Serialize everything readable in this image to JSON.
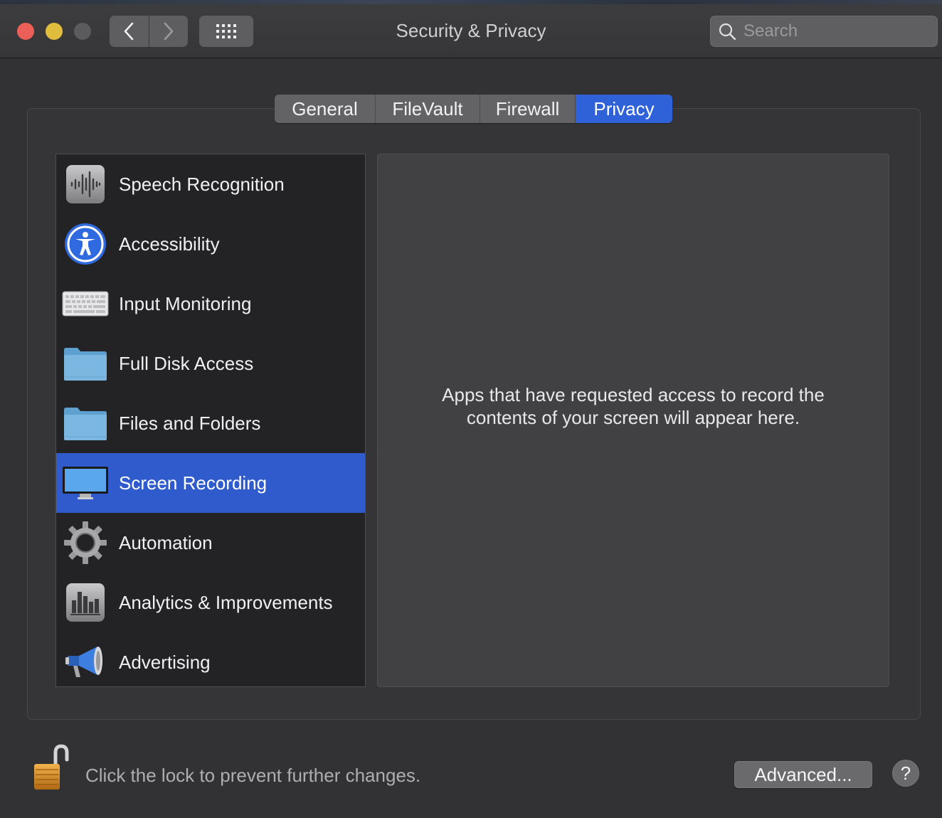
{
  "window": {
    "title": "Security & Privacy"
  },
  "search": {
    "placeholder": "Search"
  },
  "tabs": [
    {
      "label": "General"
    },
    {
      "label": "FileVault"
    },
    {
      "label": "Firewall"
    },
    {
      "label": "Privacy",
      "selected": true
    }
  ],
  "categories": [
    {
      "label": "Speech Recognition",
      "icon": "speech-waveform-icon"
    },
    {
      "label": "Accessibility",
      "icon": "accessibility-icon"
    },
    {
      "label": "Input Monitoring",
      "icon": "keyboard-icon"
    },
    {
      "label": "Full Disk Access",
      "icon": "folder-icon"
    },
    {
      "label": "Files and Folders",
      "icon": "folder-icon"
    },
    {
      "label": "Screen Recording",
      "icon": "monitor-icon",
      "selected": true
    },
    {
      "label": "Automation",
      "icon": "gear-icon"
    },
    {
      "label": "Analytics & Improvements",
      "icon": "bar-chart-icon"
    },
    {
      "label": "Advertising",
      "icon": "megaphone-icon"
    }
  ],
  "detail": {
    "empty_message": "Apps that have requested access to record the contents of your screen will appear here."
  },
  "footer": {
    "lock_message": "Click the lock to prevent further changes.",
    "advanced_label": "Advanced...",
    "help_label": "?"
  },
  "colors": {
    "accent": "#2f5bcd",
    "close": "#ec5f58",
    "minimize": "#e1bd3e"
  }
}
